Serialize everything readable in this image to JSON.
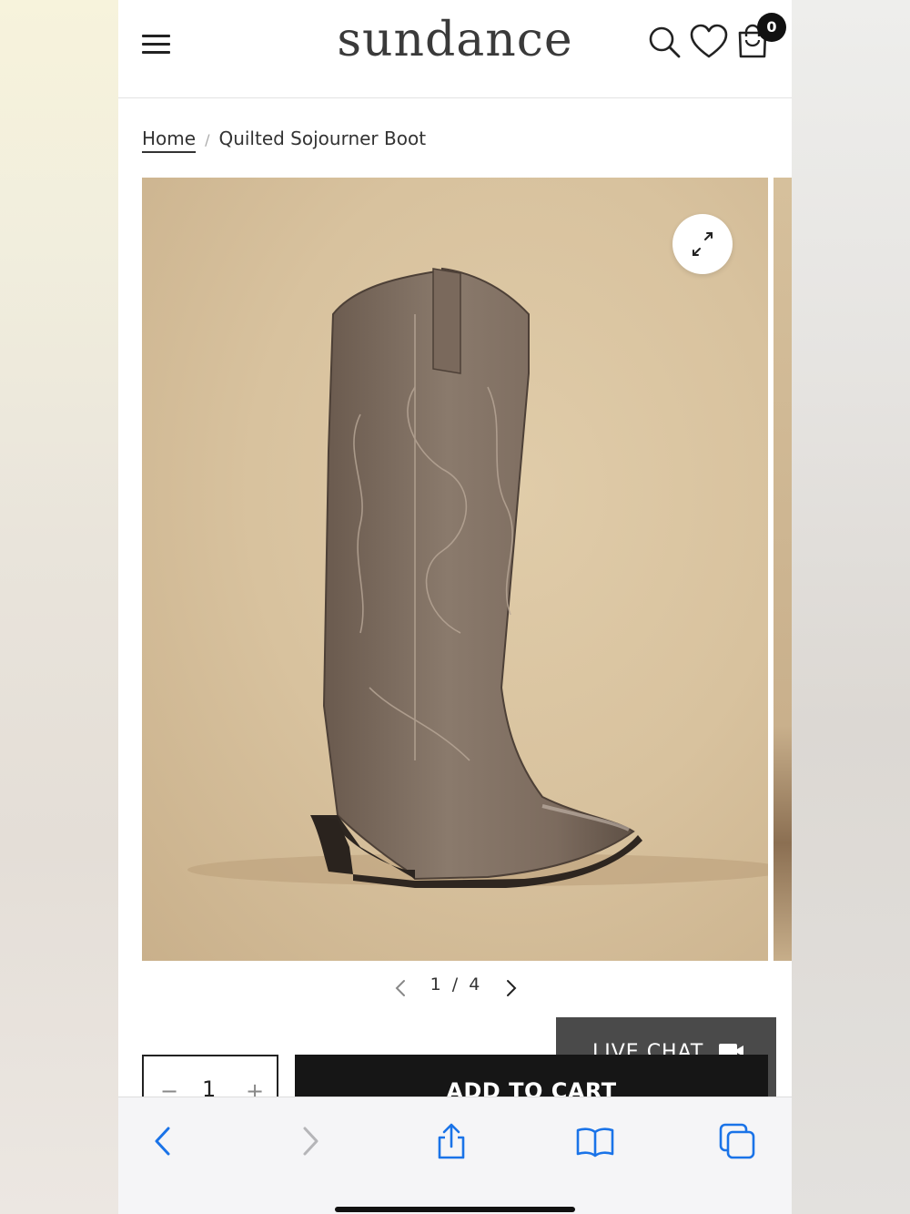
{
  "header": {
    "logo": "sundance",
    "cart_count": "0",
    "icons": [
      "menu-icon",
      "search-icon",
      "heart-icon",
      "cart-icon"
    ]
  },
  "breadcrumb": {
    "home": "Home",
    "separator": "/",
    "current": "Quilted Sojourner Boot"
  },
  "gallery": {
    "current": "1",
    "total": "4",
    "separator": "/",
    "image_description": "tall taupe suede western boot with tonal embroidery on tan backdrop"
  },
  "live_chat": {
    "label": "LIVE CHAT"
  },
  "purchase": {
    "quantity": "1",
    "minus": "−",
    "plus": "+",
    "add_to_cart": "ADD TO CART"
  },
  "browser_toolbar": {
    "icons": [
      "back-icon",
      "forward-icon",
      "share-icon",
      "bookmarks-icon",
      "tabs-icon"
    ]
  },
  "colors": {
    "accent_dark": "#161616",
    "safari_blue": "#1a73e8",
    "backdrop": "#d8c29e"
  }
}
